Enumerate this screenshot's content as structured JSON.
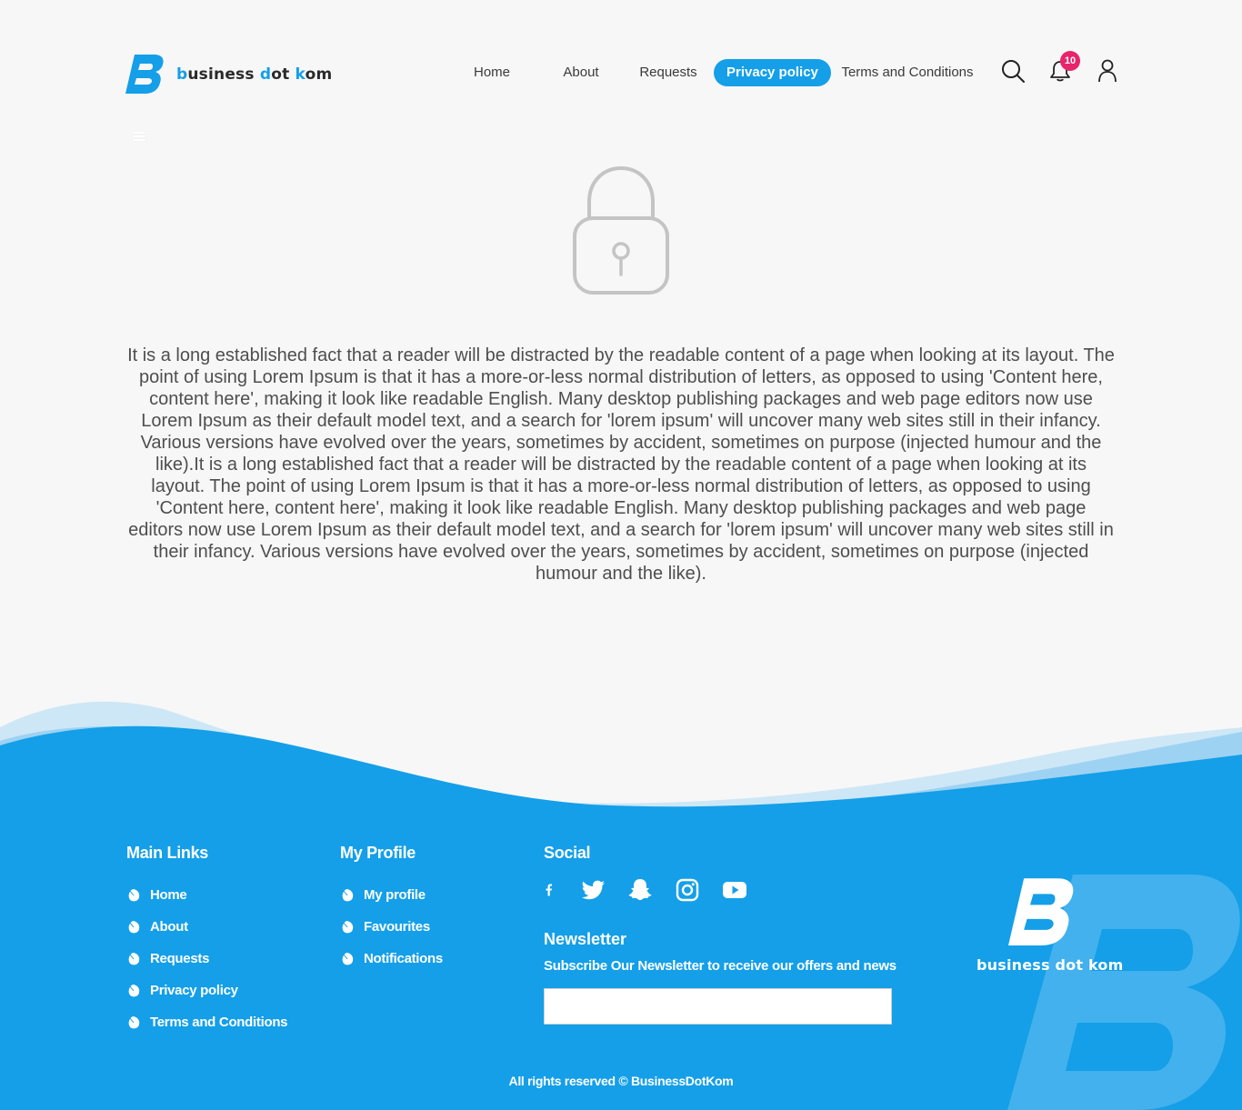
{
  "brand": {
    "name_parts": [
      "b",
      "usiness ",
      "d",
      "ot ",
      "k",
      "om"
    ],
    "footer_name": "business dot kom",
    "primary_color": "#149fe8",
    "badge_color": "#e8246b"
  },
  "nav": {
    "items": [
      {
        "label": "Home"
      },
      {
        "label": "About"
      },
      {
        "label": "Requests"
      },
      {
        "label": "Privacy policy",
        "active": true
      },
      {
        "label": "Terms and Conditions"
      }
    ],
    "search_icon": "search-icon",
    "notifications_icon": "bell-icon",
    "notification_count": "10",
    "profile_icon": "user-icon"
  },
  "page": {
    "icon": "lock-icon",
    "body": "It is a long established fact that a reader will be distracted by the readable content of a page when looking at its layout. The point of using Lorem Ipsum is that it has a more-or-less normal distribution of letters, as opposed to using 'Content here, content here', making it look like readable English. Many desktop publishing packages and web page editors now use Lorem Ipsum as their default model text, and a search for 'lorem ipsum' will uncover many web sites still in their infancy. Various versions have evolved over the years, sometimes by accident, sometimes on purpose (injected humour and the like).It is a long established fact that a reader will be distracted by the readable content of a page when looking at its layout. The point of using Lorem Ipsum is that it has a more-or-less normal distribution of letters, as opposed to using 'Content here, content here', making it look like readable English. Many desktop publishing packages and web page editors now use Lorem Ipsum as their default model text, and a search for 'lorem ipsum' will uncover many web sites still in their infancy. Various versions have evolved over the years, sometimes by accident, sometimes on purpose (injected humour and the like)."
  },
  "footer": {
    "main_links": {
      "title": "Main Links",
      "items": [
        "Home",
        "About",
        "Requests",
        "Privacy policy",
        "Terms and Conditions"
      ]
    },
    "my_profile": {
      "title": "My Profile",
      "items": [
        "My profile",
        "Favourites",
        "Notifications"
      ]
    },
    "social": {
      "title": "Social",
      "icons": [
        "facebook-icon",
        "twitter-icon",
        "snapchat-icon",
        "instagram-icon",
        "youtube-icon"
      ]
    },
    "newsletter": {
      "title": "Newsletter",
      "subtitle": "Subscribe Our Newsletter to receive our offers and news",
      "value": "",
      "placeholder": ""
    },
    "copyright": "All rights reserved © BusinessDotKom"
  }
}
